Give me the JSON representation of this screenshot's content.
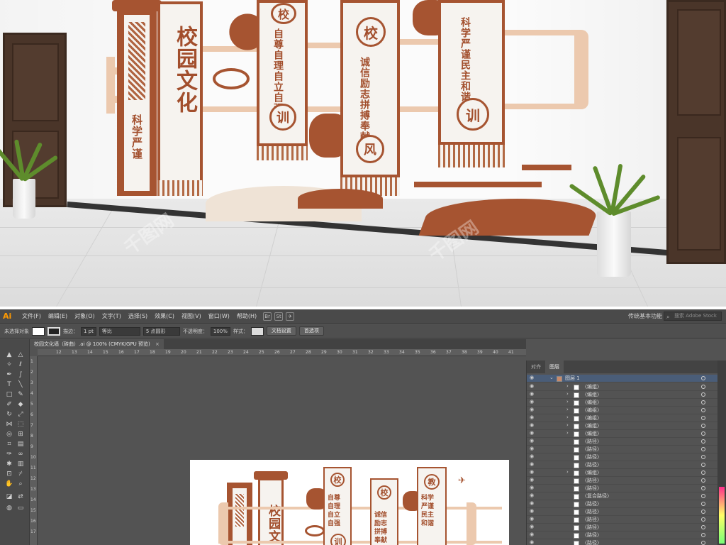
{
  "render": {
    "panels": [
      {
        "text": "校园文化",
        "style": "large"
      },
      {
        "text": "科学严谨",
        "style": "small"
      },
      {
        "text": "自尊自理自立自强",
        "style": "columns"
      },
      {
        "text": "诚信励志拼搏奉献",
        "style": "columns"
      },
      {
        "text": "科学严谨民主和谐",
        "style": "columns"
      }
    ],
    "circles": [
      "校",
      "训",
      "校",
      "风",
      "训"
    ],
    "watermark": "千图网"
  },
  "illustrator": {
    "app_logo": "Ai",
    "menu": [
      "文件(F)",
      "编辑(E)",
      "对象(O)",
      "文字(T)",
      "选择(S)",
      "效果(C)",
      "视图(V)",
      "窗口(W)",
      "帮助(H)"
    ],
    "menu_icons": [
      "Br",
      "St"
    ],
    "workspace": "传统基本功能",
    "search_placeholder": "搜索 Adobe Stock",
    "control": {
      "selection_label": "未选择对象",
      "stroke_label": "描边：",
      "stroke_value": "1 pt",
      "stroke_style": "等比",
      "brush_value": "5 点圆形",
      "opacity_label": "不透明度：",
      "opacity_value": "100%",
      "style_label": "样式：",
      "doc_setup": "文档设置",
      "preferences": "首选项"
    },
    "document_tab": "校园文化墙（砖曲）.ai @ 100% (CMYK/GPU 预览)",
    "document_tab_close": "×",
    "ruler_h": [
      "",
      "12",
      "13",
      "14",
      "15",
      "16",
      "17",
      "18",
      "19",
      "20",
      "21",
      "22",
      "23",
      "24",
      "25",
      "26",
      "27",
      "28",
      "29",
      "30",
      "31",
      "32",
      "33",
      "34",
      "35",
      "36",
      "37",
      "38",
      "39",
      "40",
      "41"
    ],
    "ruler_v": [
      "1",
      "2",
      "3",
      "4",
      "5",
      "6",
      "7",
      "8",
      "9",
      "10",
      "11",
      "12",
      "13",
      "14",
      "15",
      "16",
      "17"
    ],
    "panel_tabs": [
      "对齐",
      "图层"
    ],
    "layer_top": "图层 1",
    "layer_rows": [
      "〈编组〉",
      "〈编组〉",
      "〈编组〉",
      "〈编组〉",
      "〈编组〉",
      "〈编组〉",
      "〈编组〉",
      "〈路径〉",
      "〈路径〉",
      "〈路径〉",
      "〈路径〉",
      "〈编组〉",
      "〈路径〉",
      "〈路径〉",
      "〈复合路径〉",
      "〈路径〉",
      "〈路径〉",
      "〈路径〉",
      "〈路径〉",
      "〈路径〉",
      "〈路径〉",
      "〈路径〉"
    ],
    "artboard": {
      "columns": [
        "校",
        "园",
        "文",
        "自尊",
        "自理",
        "自立",
        "自强",
        "训",
        "校",
        "诚信",
        "励志",
        "拼搏",
        "奉献",
        "教",
        "科学",
        "严谨",
        "民主",
        "和谐"
      ]
    }
  },
  "colors": {
    "rust": "#a65431",
    "peach": "#ecc9ae",
    "panel_bg": "#535353",
    "ai_orange": "#ff9a00"
  }
}
